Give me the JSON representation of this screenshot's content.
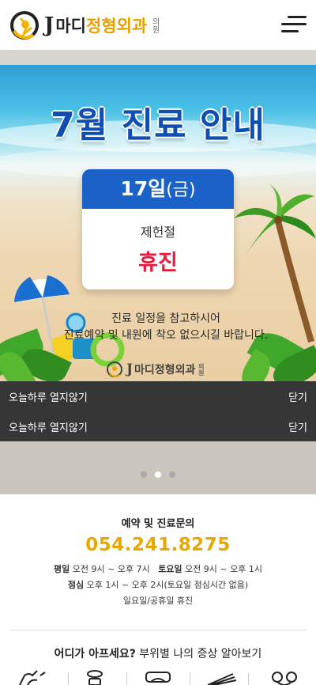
{
  "header": {
    "logo_j": "J",
    "logo_name": "마디",
    "logo_specialty": "정형외과",
    "logo_suffix": "의원",
    "menu_icon": "hamburger-menu-icon"
  },
  "popup": {
    "title": "7월 진료 안내",
    "date_main": "17일",
    "date_weekday": "(금)",
    "holiday_name": "제헌절",
    "status": "휴진",
    "notice_lines": [
      "진료 일정을 참고하시어",
      "진료예약 및 내원에 착오 없으시길 바랍니다."
    ],
    "logo_j": "J",
    "logo_text": "마디정형외과",
    "logo_suffix": "의원"
  },
  "close_bars": [
    {
      "left_label": "오늘하루 열지않기",
      "right_label": "닫기"
    },
    {
      "left_label": "오늘하루 열지않기",
      "right_label": "닫기"
    }
  ],
  "slider": {
    "total": 3,
    "active_index": 1
  },
  "info": {
    "title": "예약 및 진료문의",
    "phone": "054.241.8275",
    "weekday_label": "평일",
    "weekday_hours": "오전 9시 ~ 오후 7시",
    "saturday_label": "토요일",
    "saturday_hours": "오전 9시 ~ 오후 1시",
    "lunch_label": "점심",
    "lunch_hours": "오후 1시 ~ 오후 2시(토요일 점심시간 없음)",
    "closed_days": "일요일/공휴일 휴진"
  },
  "symptom": {
    "question": "어디가 아프세요?",
    "subtitle": "부위별 나의 증상 알아보기"
  },
  "colors": {
    "accent": "#e8a800",
    "brand_blue": "#1a61c8",
    "closed_red": "#e8193b",
    "bar_dark": "#363636"
  }
}
